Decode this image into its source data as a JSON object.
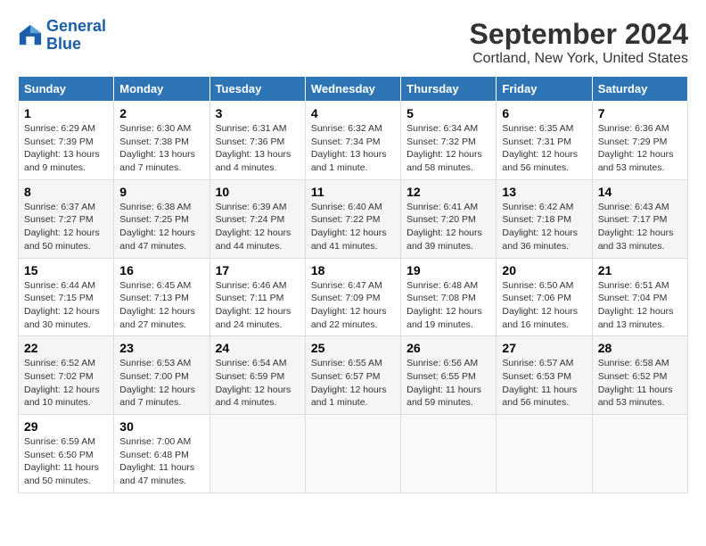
{
  "logo": {
    "text_general": "General",
    "text_blue": "Blue"
  },
  "title": "September 2024",
  "subtitle": "Cortland, New York, United States",
  "days_of_week": [
    "Sunday",
    "Monday",
    "Tuesday",
    "Wednesday",
    "Thursday",
    "Friday",
    "Saturday"
  ],
  "weeks": [
    [
      {
        "num": "1",
        "sunrise": "6:29 AM",
        "sunset": "7:39 PM",
        "daylight": "13 hours and 9 minutes."
      },
      {
        "num": "2",
        "sunrise": "6:30 AM",
        "sunset": "7:38 PM",
        "daylight": "13 hours and 7 minutes."
      },
      {
        "num": "3",
        "sunrise": "6:31 AM",
        "sunset": "7:36 PM",
        "daylight": "13 hours and 4 minutes."
      },
      {
        "num": "4",
        "sunrise": "6:32 AM",
        "sunset": "7:34 PM",
        "daylight": "13 hours and 1 minute."
      },
      {
        "num": "5",
        "sunrise": "6:34 AM",
        "sunset": "7:32 PM",
        "daylight": "12 hours and 58 minutes."
      },
      {
        "num": "6",
        "sunrise": "6:35 AM",
        "sunset": "7:31 PM",
        "daylight": "12 hours and 56 minutes."
      },
      {
        "num": "7",
        "sunrise": "6:36 AM",
        "sunset": "7:29 PM",
        "daylight": "12 hours and 53 minutes."
      }
    ],
    [
      {
        "num": "8",
        "sunrise": "6:37 AM",
        "sunset": "7:27 PM",
        "daylight": "12 hours and 50 minutes."
      },
      {
        "num": "9",
        "sunrise": "6:38 AM",
        "sunset": "7:25 PM",
        "daylight": "12 hours and 47 minutes."
      },
      {
        "num": "10",
        "sunrise": "6:39 AM",
        "sunset": "7:24 PM",
        "daylight": "12 hours and 44 minutes."
      },
      {
        "num": "11",
        "sunrise": "6:40 AM",
        "sunset": "7:22 PM",
        "daylight": "12 hours and 41 minutes."
      },
      {
        "num": "12",
        "sunrise": "6:41 AM",
        "sunset": "7:20 PM",
        "daylight": "12 hours and 39 minutes."
      },
      {
        "num": "13",
        "sunrise": "6:42 AM",
        "sunset": "7:18 PM",
        "daylight": "12 hours and 36 minutes."
      },
      {
        "num": "14",
        "sunrise": "6:43 AM",
        "sunset": "7:17 PM",
        "daylight": "12 hours and 33 minutes."
      }
    ],
    [
      {
        "num": "15",
        "sunrise": "6:44 AM",
        "sunset": "7:15 PM",
        "daylight": "12 hours and 30 minutes."
      },
      {
        "num": "16",
        "sunrise": "6:45 AM",
        "sunset": "7:13 PM",
        "daylight": "12 hours and 27 minutes."
      },
      {
        "num": "17",
        "sunrise": "6:46 AM",
        "sunset": "7:11 PM",
        "daylight": "12 hours and 24 minutes."
      },
      {
        "num": "18",
        "sunrise": "6:47 AM",
        "sunset": "7:09 PM",
        "daylight": "12 hours and 22 minutes."
      },
      {
        "num": "19",
        "sunrise": "6:48 AM",
        "sunset": "7:08 PM",
        "daylight": "12 hours and 19 minutes."
      },
      {
        "num": "20",
        "sunrise": "6:50 AM",
        "sunset": "7:06 PM",
        "daylight": "12 hours and 16 minutes."
      },
      {
        "num": "21",
        "sunrise": "6:51 AM",
        "sunset": "7:04 PM",
        "daylight": "12 hours and 13 minutes."
      }
    ],
    [
      {
        "num": "22",
        "sunrise": "6:52 AM",
        "sunset": "7:02 PM",
        "daylight": "12 hours and 10 minutes."
      },
      {
        "num": "23",
        "sunrise": "6:53 AM",
        "sunset": "7:00 PM",
        "daylight": "12 hours and 7 minutes."
      },
      {
        "num": "24",
        "sunrise": "6:54 AM",
        "sunset": "6:59 PM",
        "daylight": "12 hours and 4 minutes."
      },
      {
        "num": "25",
        "sunrise": "6:55 AM",
        "sunset": "6:57 PM",
        "daylight": "12 hours and 1 minute."
      },
      {
        "num": "26",
        "sunrise": "6:56 AM",
        "sunset": "6:55 PM",
        "daylight": "11 hours and 59 minutes."
      },
      {
        "num": "27",
        "sunrise": "6:57 AM",
        "sunset": "6:53 PM",
        "daylight": "11 hours and 56 minutes."
      },
      {
        "num": "28",
        "sunrise": "6:58 AM",
        "sunset": "6:52 PM",
        "daylight": "11 hours and 53 minutes."
      }
    ],
    [
      {
        "num": "29",
        "sunrise": "6:59 AM",
        "sunset": "6:50 PM",
        "daylight": "11 hours and 50 minutes."
      },
      {
        "num": "30",
        "sunrise": "7:00 AM",
        "sunset": "6:48 PM",
        "daylight": "11 hours and 47 minutes."
      },
      null,
      null,
      null,
      null,
      null
    ]
  ]
}
